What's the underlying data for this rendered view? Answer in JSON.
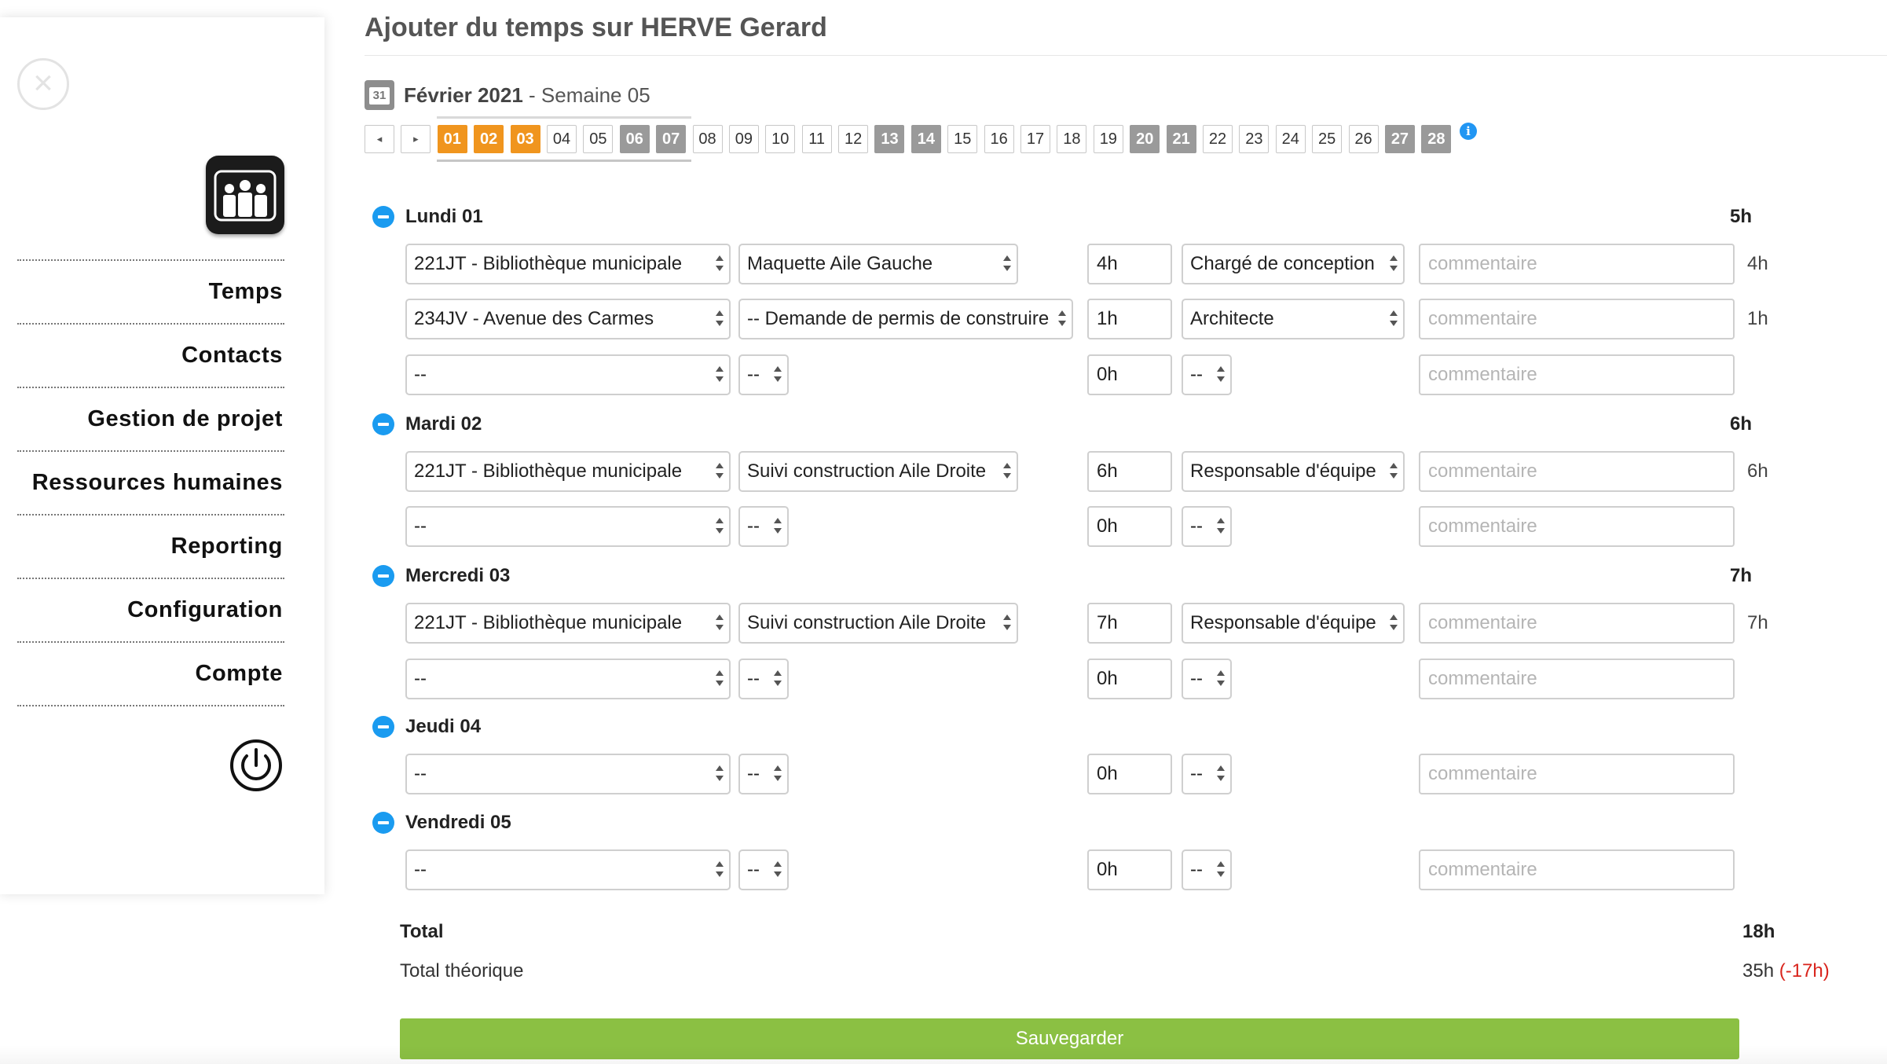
{
  "sidebar": {
    "close_icon": "close-icon",
    "logo_icon": "team-logo-icon",
    "items": [
      {
        "label": "Temps"
      },
      {
        "label": "Contacts"
      },
      {
        "label": "Gestion de projet"
      },
      {
        "label": "Ressources humaines"
      },
      {
        "label": "Reporting"
      },
      {
        "label": "Configuration"
      },
      {
        "label": "Compte"
      }
    ],
    "power_icon": "power-icon"
  },
  "page": {
    "title": "Ajouter du temps sur HERVE Gerard",
    "calendar_icon_text": "31",
    "month": "Février 2021",
    "week": " - Semaine 05"
  },
  "day_strip": {
    "prev": "◂",
    "next": "▸",
    "days": [
      "01",
      "02",
      "03",
      "04",
      "05",
      "06",
      "07",
      "08",
      "09",
      "10",
      "11",
      "12",
      "13",
      "14",
      "15",
      "16",
      "17",
      "18",
      "19",
      "20",
      "21",
      "22",
      "23",
      "24",
      "25",
      "26",
      "27",
      "28"
    ],
    "selected": [
      "01",
      "02",
      "03"
    ],
    "weekend": [
      "06",
      "07",
      "13",
      "14",
      "20",
      "21",
      "27",
      "28"
    ],
    "info": "i"
  },
  "days": [
    {
      "name": "Lundi 01",
      "total": "5h",
      "rows": [
        {
          "project": "221JT - Bibliothèque municipale",
          "task": "Maquette Aile Gauche",
          "hours": "4h",
          "role": "Chargé de conception",
          "comment_placeholder": "commentaire",
          "row_total": "4h"
        },
        {
          "project": "234JV - Avenue des Carmes",
          "task": "-- Demande de permis de construire",
          "hours": "1h",
          "role": "Architecte",
          "comment_placeholder": "commentaire",
          "row_total": "1h"
        },
        {
          "project": "--",
          "task": "--",
          "hours": "0h",
          "role": "--",
          "comment_placeholder": "commentaire",
          "row_total": ""
        }
      ]
    },
    {
      "name": "Mardi 02",
      "total": "6h",
      "rows": [
        {
          "project": "221JT - Bibliothèque municipale",
          "task": "Suivi construction Aile Droite",
          "hours": "6h",
          "role": "Responsable d'équipe",
          "comment_placeholder": "commentaire",
          "row_total": "6h"
        },
        {
          "project": "--",
          "task": "--",
          "hours": "0h",
          "role": "--",
          "comment_placeholder": "commentaire",
          "row_total": ""
        }
      ]
    },
    {
      "name": "Mercredi 03",
      "total": "7h",
      "rows": [
        {
          "project": "221JT - Bibliothèque municipale",
          "task": "Suivi construction Aile Droite",
          "hours": "7h",
          "role": "Responsable d'équipe",
          "comment_placeholder": "commentaire",
          "row_total": "7h"
        },
        {
          "project": "--",
          "task": "--",
          "hours": "0h",
          "role": "--",
          "comment_placeholder": "commentaire",
          "row_total": ""
        }
      ]
    },
    {
      "name": "Jeudi 04",
      "total": "",
      "rows": [
        {
          "project": "--",
          "task": "--",
          "hours": "0h",
          "role": "--",
          "comment_placeholder": "commentaire",
          "row_total": ""
        }
      ]
    },
    {
      "name": "Vendredi 05",
      "total": "",
      "rows": [
        {
          "project": "--",
          "task": "--",
          "hours": "0h",
          "role": "--",
          "comment_placeholder": "commentaire",
          "row_total": ""
        }
      ]
    }
  ],
  "totals": {
    "total_label": "Total",
    "total_value": "18h",
    "theoretical_label": "Total théorique",
    "theoretical_value": "35h",
    "theoretical_diff": "(-17h)"
  },
  "save_label": "Sauvegarder",
  "colors": {
    "selected_day": "#f0951e",
    "weekend_day": "#9a9a9a",
    "day_toggle": "#1a9bf0",
    "save_button": "#8bc043",
    "negative_diff": "#d9241c"
  }
}
